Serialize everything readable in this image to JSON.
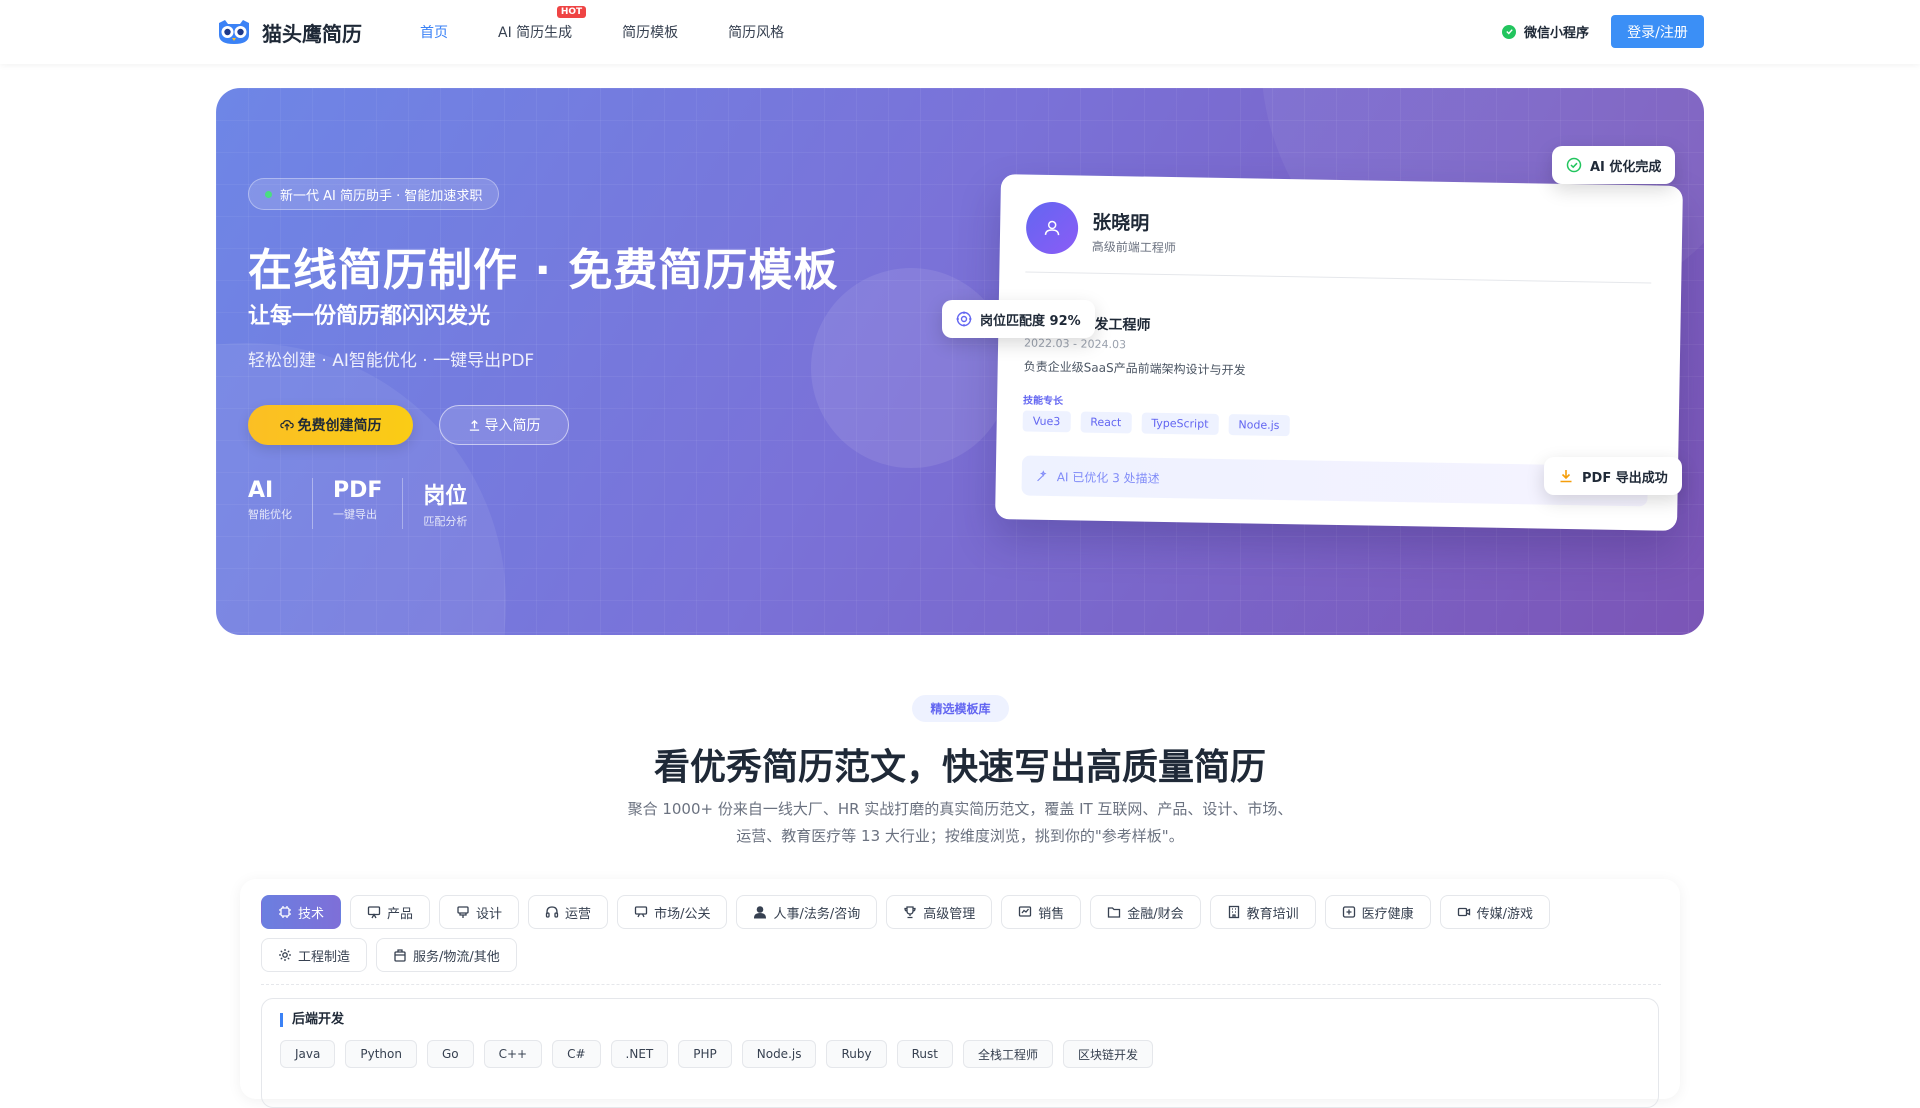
{
  "header": {
    "logo_text": "猫头鹰简历",
    "nav": [
      {
        "label": "首页",
        "active": true
      },
      {
        "label": "AI 简历生成",
        "badge": "HOT"
      },
      {
        "label": "简历模板"
      },
      {
        "label": "简历风格"
      }
    ],
    "mini_program": "微信小程序",
    "login": "登录/注册"
  },
  "hero": {
    "badge": "新一代 AI 简历助手 · 智能加速求职",
    "title": "在线简历制作 · 免费简历模板",
    "subtitle": "让每一份简历都闪闪发光",
    "tagline": "轻松创建 · AI智能优化 · 一键导出PDF",
    "btn_create": "免费创建简历",
    "btn_import": "导入简历",
    "stats": [
      {
        "value": "AI",
        "label": "智能优化"
      },
      {
        "value": "PDF",
        "label": "一键导出"
      },
      {
        "value": "岗位",
        "label": "匹配分析"
      }
    ]
  },
  "resume_card": {
    "name": "张晓明",
    "role": "高级前端工程师",
    "job_title": "高级前端开发工程师",
    "job_title_visible": "端开发工程师",
    "job_date": "2022.03 - 2024.03",
    "job_desc": "负责企业级SaaS产品前端架构设计与开发",
    "skills_label": "技能专长",
    "skills": [
      "Vue3",
      "React",
      "TypeScript",
      "Node.js"
    ],
    "ai_optimized": "AI 已优化 3 处描述"
  },
  "floats": {
    "ai_done": "AI 优化完成",
    "match": "岗位匹配度 92%",
    "pdf": "PDF 导出成功"
  },
  "templates": {
    "pill": "精选模板库",
    "title": "看优秀简历范文，快速写出高质量简历",
    "desc_line1": "聚合 1000+ 份来自一线大厂、HR 实战打磨的真实简历范文，覆盖 IT 互联网、产品、设计、市场、",
    "desc_line2": "运营、教育医疗等 13 大行业；按维度浏览，挑到你的\"参考样板\"。",
    "categories": [
      {
        "label": "技术",
        "icon": "chip-icon",
        "active": true
      },
      {
        "label": "产品",
        "icon": "board-icon"
      },
      {
        "label": "设计",
        "icon": "palette-icon"
      },
      {
        "label": "运营",
        "icon": "headset-icon"
      },
      {
        "label": "市场/公关",
        "icon": "presentation-icon"
      },
      {
        "label": "人事/法务/咨询",
        "icon": "person-icon"
      },
      {
        "label": "高级管理",
        "icon": "trophy-icon"
      },
      {
        "label": "销售",
        "icon": "chart-icon"
      },
      {
        "label": "金融/财会",
        "icon": "folder-icon"
      },
      {
        "label": "教育培训",
        "icon": "building-icon"
      },
      {
        "label": "医疗健康",
        "icon": "medical-icon"
      },
      {
        "label": "传媒/游戏",
        "icon": "video-icon"
      },
      {
        "label": "工程制造",
        "icon": "gear-icon"
      },
      {
        "label": "服务/物流/其他",
        "icon": "bag-icon"
      }
    ],
    "sub_title": "后端开发",
    "langs": [
      "Java",
      "Python",
      "Go",
      "C++",
      "C#",
      ".NET",
      "PHP",
      "Node.js",
      "Ruby",
      "Rust",
      "全栈工程师",
      "区块链开发"
    ]
  },
  "colors": {
    "accent": "#3b82f6",
    "hero_start": "#6e86e6",
    "hero_end": "#7b55b6",
    "cta_yellow": "#fbbf24"
  }
}
